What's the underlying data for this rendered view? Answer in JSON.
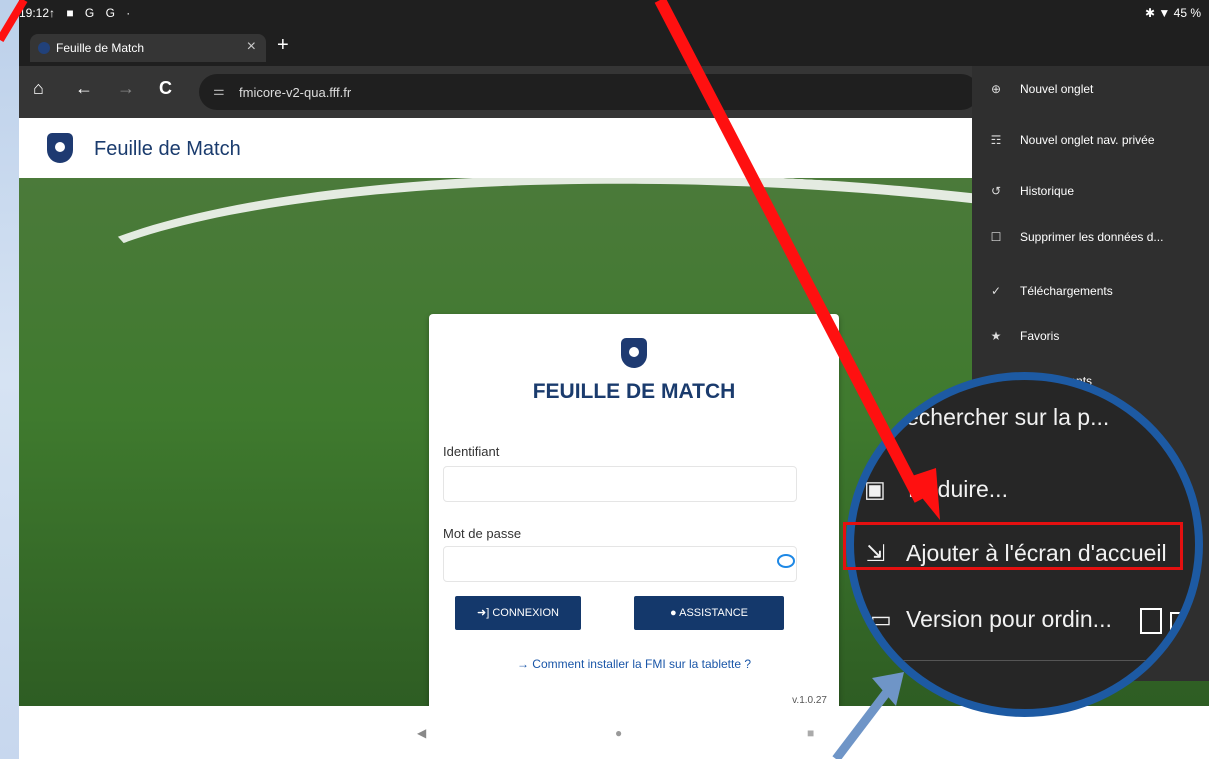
{
  "status_bar": {
    "time": "19:12",
    "left_icons": "↑ ■ G G ·",
    "right_icons": "✱ ▼ 45 %"
  },
  "browser": {
    "tab_title": "Feuille de Match",
    "tab_close": "×",
    "new_tab": "+",
    "url": "fmicore-v2-qua.fff.fr",
    "nav": {
      "home": "⌂",
      "back": "←",
      "forward": "→",
      "reload": "C"
    }
  },
  "site": {
    "title": "Feuille de Match"
  },
  "login": {
    "heading": "FEUILLE DE MATCH",
    "identifiant_label": "Identifiant",
    "password_label": "Mot de passe",
    "connexion_button": "CONNEXION",
    "assistance_button": "ASSISTANCE",
    "install_link": "→ Comment installer la FMI sur la tablette ?",
    "version": "v.1.0.27"
  },
  "menu": {
    "items": [
      {
        "icon": "⊕",
        "label": "Nouvel onglet"
      },
      {
        "icon": "☶",
        "label": "Nouvel onglet nav. privée"
      },
      {
        "icon": "↺",
        "label": "Historique"
      },
      {
        "icon": "☐",
        "label": "Supprimer les données d..."
      },
      {
        "icon": "✓",
        "label": "Téléchargements"
      },
      {
        "icon": "★",
        "label": "Favoris"
      },
      {
        "icon": "☰",
        "label": "...tets récents"
      }
    ]
  },
  "magnified": {
    "search": "echercher sur la p...",
    "translate": "Traduire...",
    "add_home": "Ajouter à l'écran d'accueil",
    "desktop": "Version pour ordin..."
  },
  "colors": {
    "brand_navy": "#14386b",
    "highlight_red": "#e41010",
    "magnifier_blue": "#1d5aa3"
  }
}
